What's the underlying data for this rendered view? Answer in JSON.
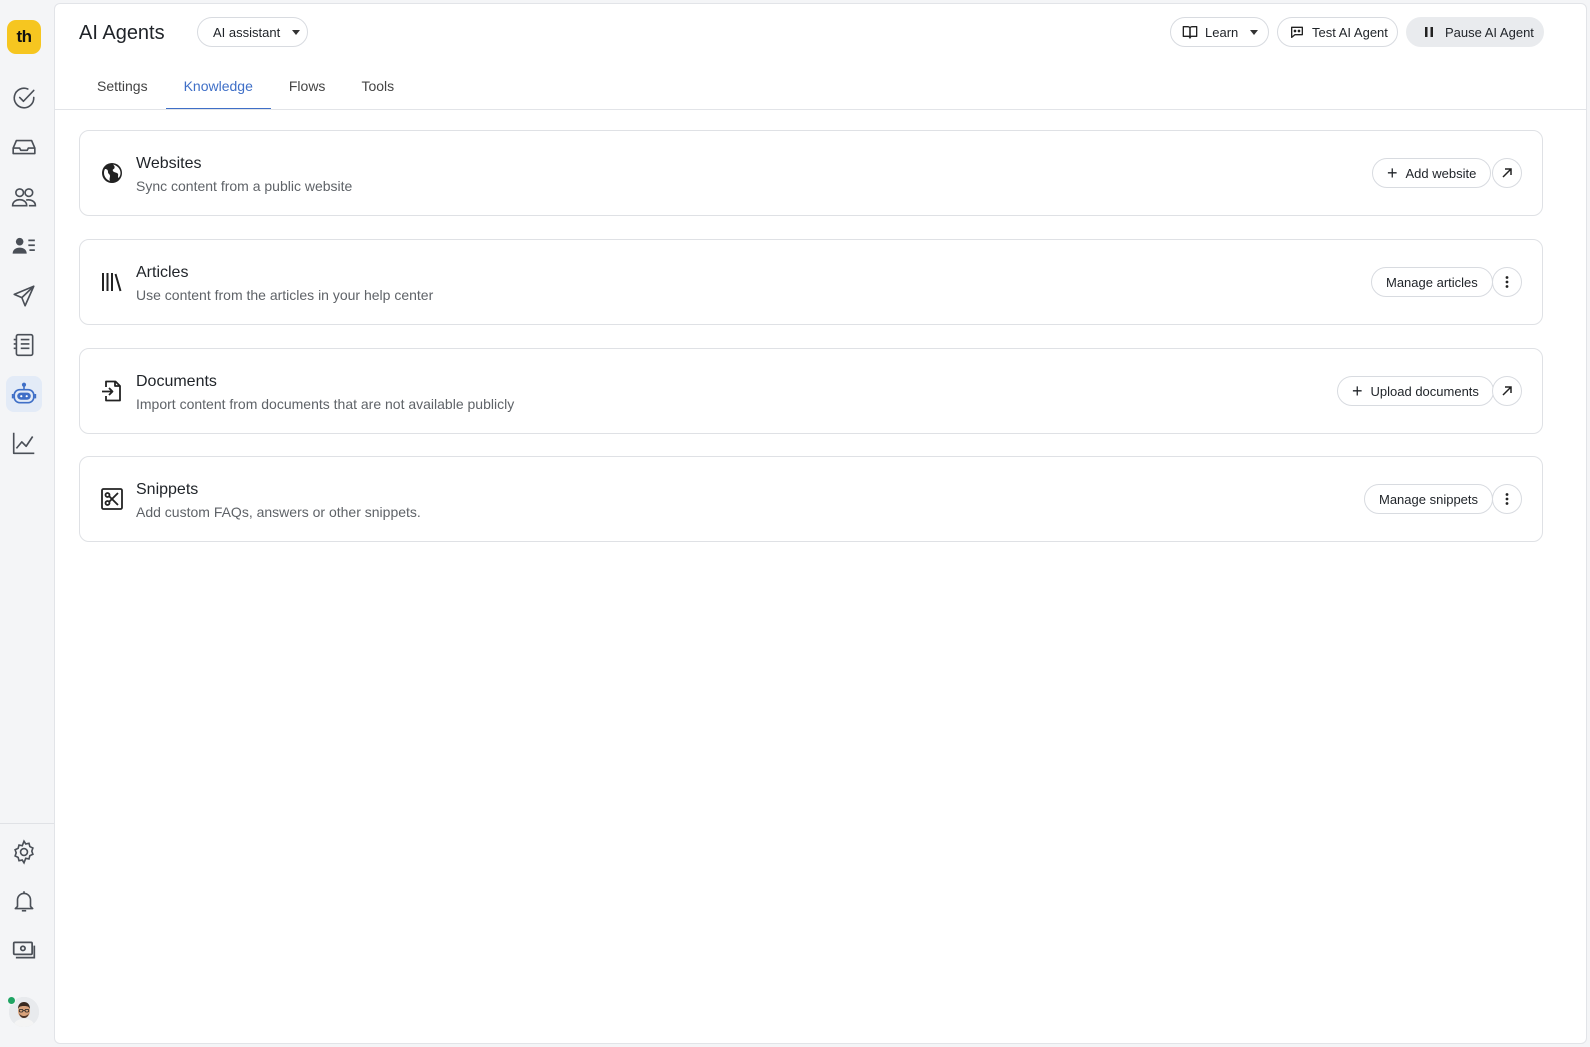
{
  "app": {
    "logo_text": "th",
    "brand_color": "#f6c620",
    "accent_color": "#3f6fc7",
    "presence_color": "#1fa463"
  },
  "rail": {
    "items": [
      {
        "icon": "check-circle-icon"
      },
      {
        "icon": "inbox-icon"
      },
      {
        "icon": "people-icon"
      },
      {
        "icon": "contacts-icon"
      },
      {
        "icon": "send-icon"
      },
      {
        "icon": "list-icon"
      },
      {
        "icon": "robot-icon",
        "active": true
      },
      {
        "icon": "chart-icon"
      }
    ],
    "bottom": [
      {
        "icon": "gear-icon"
      },
      {
        "icon": "bell-icon"
      },
      {
        "icon": "billing-icon"
      }
    ]
  },
  "header": {
    "title": "AI Agents",
    "agent_select": "AI assistant",
    "learn_label": "Learn",
    "test_label": "Test AI Agent",
    "pause_label": "Pause AI Agent"
  },
  "tabs": [
    {
      "label": "Settings"
    },
    {
      "label": "Knowledge",
      "active": true
    },
    {
      "label": "Flows"
    },
    {
      "label": "Tools"
    }
  ],
  "cards": [
    {
      "title": "Websites",
      "desc": "Sync content from a public website",
      "button": "Add website",
      "icon": "globe-icon",
      "secondary": "external-link-icon"
    },
    {
      "title": "Articles",
      "desc": "Use content from the articles in your help center",
      "button": "Manage articles",
      "icon": "library-icon",
      "secondary": "more-vertical-icon"
    },
    {
      "title": "Documents",
      "desc": "Import content from documents that are not available publicly",
      "button": "Upload documents",
      "icon": "file-import-icon",
      "secondary": "external-link-icon"
    },
    {
      "title": "Snippets",
      "desc": "Add custom FAQs, answers or other snippets.",
      "button": "Manage snippets",
      "icon": "snippet-icon",
      "secondary": "more-vertical-icon"
    }
  ]
}
